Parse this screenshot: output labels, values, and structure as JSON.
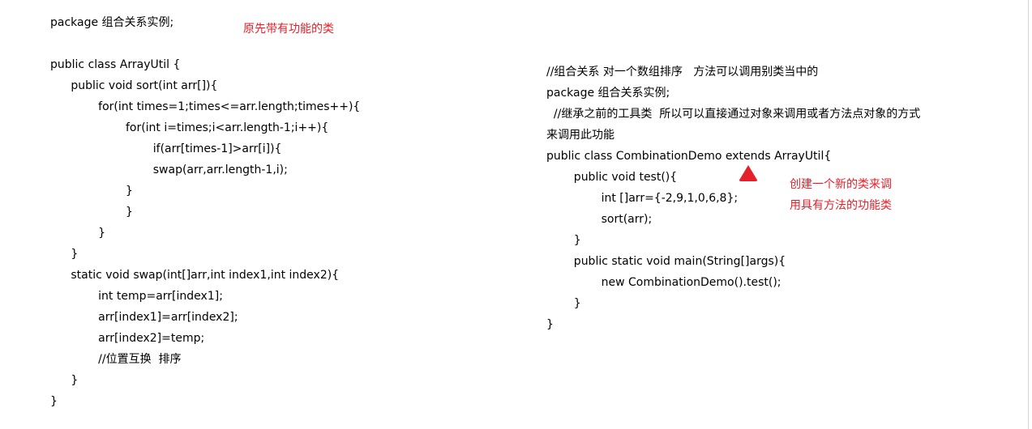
{
  "left_code": {
    "lines": [
      "package 组合关系实例;",
      "",
      "public class ArrayUtil {",
      "   public void sort(int arr[]){",
      "       for(int times=1;times<=arr.length;times++){",
      "           for(int i=times;i<arr.length-1;i++){",
      "               if(arr[times-1]>arr[i]){",
      "               swap(arr,arr.length-1,i);",
      "           }",
      "           }",
      "       }",
      "   }",
      "   static void swap(int[]arr,int index1,int index2){",
      "       int temp=arr[index1];",
      "       arr[index1]=arr[index2];",
      "       arr[index2]=temp;",
      "       //位置互换  排序",
      "   }",
      "}"
    ],
    "note": "原先带有功能的类"
  },
  "right_code": {
    "lines": [
      "//组合关系 对一个数组排序   方法可以调用别类当中的",
      "package 组合关系实例;",
      "  //继承之前的工具类  所以可以直接通过对象来调用或者方法点对象的方式",
      "来调用此功能",
      "public class CombinationDemo extends ArrayUtil{",
      "    public void test(){",
      "        int []arr={-2,9,1,0,6,8};",
      "        sort(arr);",
      "    }",
      "    public static void main(String[]args){",
      "        new CombinationDemo().test();",
      "    }",
      "}"
    ],
    "note_line1": "创建一个新的类来调",
    "note_line2": "用具有方法的功能类",
    "arrow_color": "#e5202a"
  }
}
